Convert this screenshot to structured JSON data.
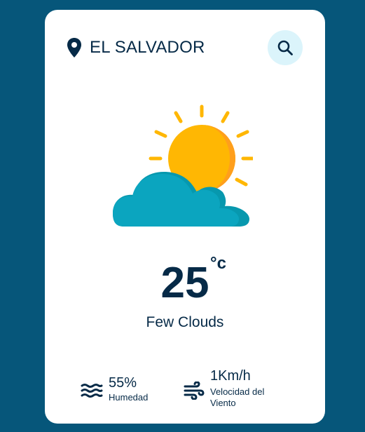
{
  "location": {
    "name": "EL SALVADOR",
    "icon": "map-pin-icon"
  },
  "search": {
    "icon": "search-icon"
  },
  "weather": {
    "icon": "sun-behind-cloud-icon",
    "temperature": "25",
    "unit": "°c",
    "description": "Few Clouds"
  },
  "stats": {
    "humidity": {
      "value": "55%",
      "label": "Humedad",
      "icon": "waves-icon"
    },
    "wind": {
      "value": "1Km/h",
      "label_line1": "Velocidad del",
      "label_line2": "Viento",
      "icon": "wind-icon"
    }
  },
  "colors": {
    "background": "#06567a",
    "card": "#ffffff",
    "text": "#062a47",
    "search_bg": "#dbf4fb",
    "sun": "#ffb703",
    "cloud": "#0ba5bf"
  }
}
